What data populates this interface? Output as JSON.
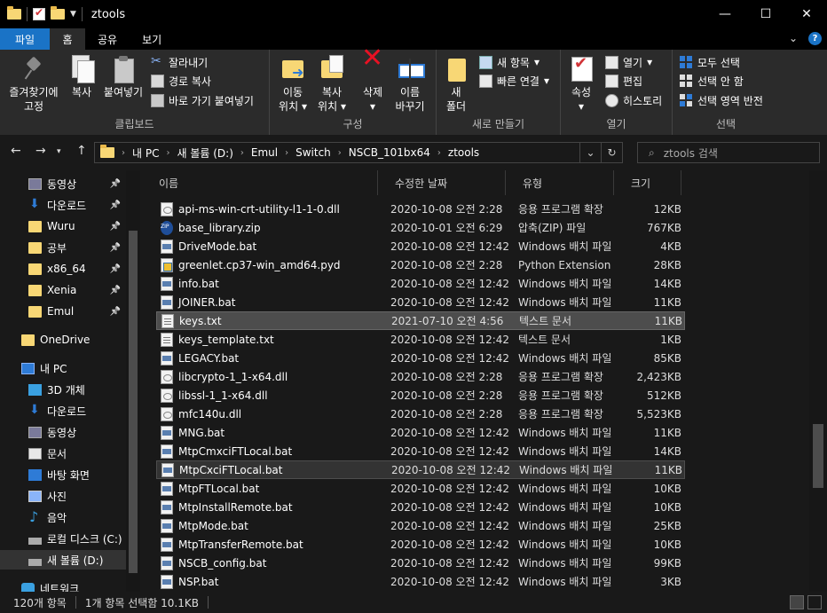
{
  "window": {
    "title": "ztools",
    "controls": [
      "—",
      "☐",
      "✕"
    ]
  },
  "tabs": {
    "file": "파일",
    "home": "홈",
    "share": "공유",
    "view": "보기"
  },
  "ribbon": {
    "clipboard": {
      "pin": "즐겨찾기에\n고정",
      "pin_l1": "즐겨찾기에",
      "pin_l2": "고정",
      "copy": "복사",
      "paste": "붙여넣기",
      "cut": "잘라내기",
      "copy_path": "경로 복사",
      "paste_shortcut": "바로 가기 붙여넣기",
      "label": "클립보드"
    },
    "organize": {
      "move_l1": "이동",
      "move_l2": "위치",
      "copy_l1": "복사",
      "copy_l2": "위치",
      "delete": "삭제",
      "rename_l1": "이름",
      "rename_l2": "바꾸기",
      "label": "구성"
    },
    "new": {
      "folder_l1": "새",
      "folder_l2": "폴더",
      "new_item": "새 항목",
      "easy_access": "빠른 연결",
      "label": "새로 만들기"
    },
    "open": {
      "properties": "속성",
      "open": "열기",
      "edit": "편집",
      "history": "히스토리",
      "label": "열기"
    },
    "select": {
      "select_all": "모두 선택",
      "select_none": "선택 안 함",
      "invert": "선택 영역 반전",
      "label": "선택"
    }
  },
  "address": {
    "crumbs": [
      "내 PC",
      "새 볼륨 (D:)",
      "Emul",
      "Switch",
      "NSCB_101bx64",
      "ztools"
    ],
    "search_placeholder": "ztools 검색"
  },
  "navpane": {
    "items": [
      {
        "label": "동영상",
        "icon": "video-icon",
        "pinned": true
      },
      {
        "label": "다운로드",
        "icon": "download-icon",
        "pinned": true
      },
      {
        "label": "Wuru",
        "icon": "folder-icon",
        "pinned": true
      },
      {
        "label": "공부",
        "icon": "folder-icon",
        "pinned": true
      },
      {
        "label": "x86_64",
        "icon": "folder-icon",
        "pinned": true
      },
      {
        "label": "Xenia",
        "icon": "folder-icon",
        "pinned": true
      },
      {
        "label": "Emul",
        "icon": "folder-icon",
        "pinned": true
      },
      {
        "label": "OneDrive",
        "icon": "onedrive-icon",
        "pinned": false
      },
      {
        "label": "내 PC",
        "icon": "pc-icon",
        "pinned": false
      },
      {
        "label": "3D 개체",
        "icon": "3d-objects-icon",
        "pinned": false
      },
      {
        "label": "다운로드",
        "icon": "download-icon",
        "pinned": false
      },
      {
        "label": "동영상",
        "icon": "video-icon",
        "pinned": false
      },
      {
        "label": "문서",
        "icon": "documents-icon",
        "pinned": false
      },
      {
        "label": "바탕 화면",
        "icon": "desktop-icon",
        "pinned": false
      },
      {
        "label": "사진",
        "icon": "pictures-icon",
        "pinned": false
      },
      {
        "label": "음악",
        "icon": "music-icon",
        "pinned": false
      },
      {
        "label": "로컬 디스크 (C:)",
        "icon": "drive-icon",
        "pinned": false
      },
      {
        "label": "새 볼륨 (D:)",
        "icon": "drive-icon",
        "pinned": false
      },
      {
        "label": "네트워크",
        "icon": "network-icon",
        "pinned": false
      }
    ]
  },
  "filelist": {
    "columns": {
      "name": "이름",
      "date": "수정한 날짜",
      "type": "유형",
      "size": "크기"
    },
    "rows": [
      {
        "name": "api-ms-win-crt-utility-l1-1-0.dll",
        "date": "2020-10-08 오전 2:28",
        "type": "응용 프로그램 확장",
        "size": "12KB",
        "kind": "dll"
      },
      {
        "name": "base_library.zip",
        "date": "2020-10-01 오전 6:29",
        "type": "압축(ZIP) 파일",
        "size": "767KB",
        "kind": "zip"
      },
      {
        "name": "DriveMode.bat",
        "date": "2020-10-08 오전 12:42",
        "type": "Windows 배치 파일",
        "size": "4KB",
        "kind": "bat"
      },
      {
        "name": "greenlet.cp37-win_amd64.pyd",
        "date": "2020-10-08 오전 2:28",
        "type": "Python Extension ...",
        "size": "28KB",
        "kind": "pyd"
      },
      {
        "name": "info.bat",
        "date": "2020-10-08 오전 12:42",
        "type": "Windows 배치 파일",
        "size": "14KB",
        "kind": "bat"
      },
      {
        "name": "JOINER.bat",
        "date": "2020-10-08 오전 12:42",
        "type": "Windows 배치 파일",
        "size": "11KB",
        "kind": "bat"
      },
      {
        "name": "keys.txt",
        "date": "2021-07-10 오전 4:56",
        "type": "텍스트 문서",
        "size": "11KB",
        "kind": "txt"
      },
      {
        "name": "keys_template.txt",
        "date": "2020-10-08 오전 12:42",
        "type": "텍스트 문서",
        "size": "1KB",
        "kind": "txt"
      },
      {
        "name": "LEGACY.bat",
        "date": "2020-10-08 오전 12:42",
        "type": "Windows 배치 파일",
        "size": "85KB",
        "kind": "bat"
      },
      {
        "name": "libcrypto-1_1-x64.dll",
        "date": "2020-10-08 오전 2:28",
        "type": "응용 프로그램 확장",
        "size": "2,423KB",
        "kind": "dll"
      },
      {
        "name": "libssl-1_1-x64.dll",
        "date": "2020-10-08 오전 2:28",
        "type": "응용 프로그램 확장",
        "size": "512KB",
        "kind": "dll"
      },
      {
        "name": "mfc140u.dll",
        "date": "2020-10-08 오전 2:28",
        "type": "응용 프로그램 확장",
        "size": "5,523KB",
        "kind": "dll"
      },
      {
        "name": "MNG.bat",
        "date": "2020-10-08 오전 12:42",
        "type": "Windows 배치 파일",
        "size": "11KB",
        "kind": "bat"
      },
      {
        "name": "MtpCmxciFTLocal.bat",
        "date": "2020-10-08 오전 12:42",
        "type": "Windows 배치 파일",
        "size": "14KB",
        "kind": "bat"
      },
      {
        "name": "MtpCxciFTLocal.bat",
        "date": "2020-10-08 오전 12:42",
        "type": "Windows 배치 파일",
        "size": "11KB",
        "kind": "bat"
      },
      {
        "name": "MtpFTLocal.bat",
        "date": "2020-10-08 오전 12:42",
        "type": "Windows 배치 파일",
        "size": "10KB",
        "kind": "bat"
      },
      {
        "name": "MtpInstallRemote.bat",
        "date": "2020-10-08 오전 12:42",
        "type": "Windows 배치 파일",
        "size": "10KB",
        "kind": "bat"
      },
      {
        "name": "MtpMode.bat",
        "date": "2020-10-08 오전 12:42",
        "type": "Windows 배치 파일",
        "size": "25KB",
        "kind": "bat"
      },
      {
        "name": "MtpTransferRemote.bat",
        "date": "2020-10-08 오전 12:42",
        "type": "Windows 배치 파일",
        "size": "10KB",
        "kind": "bat"
      },
      {
        "name": "NSCB_config.bat",
        "date": "2020-10-08 오전 12:42",
        "type": "Windows 배치 파일",
        "size": "99KB",
        "kind": "bat"
      },
      {
        "name": "NSP.bat",
        "date": "2020-10-08 오전 12:42",
        "type": "Windows 배치 파일",
        "size": "3KB",
        "kind": "bat"
      }
    ]
  },
  "status": {
    "count": "120개 항목",
    "selected": "1개 항목 선택함 10.1KB"
  }
}
